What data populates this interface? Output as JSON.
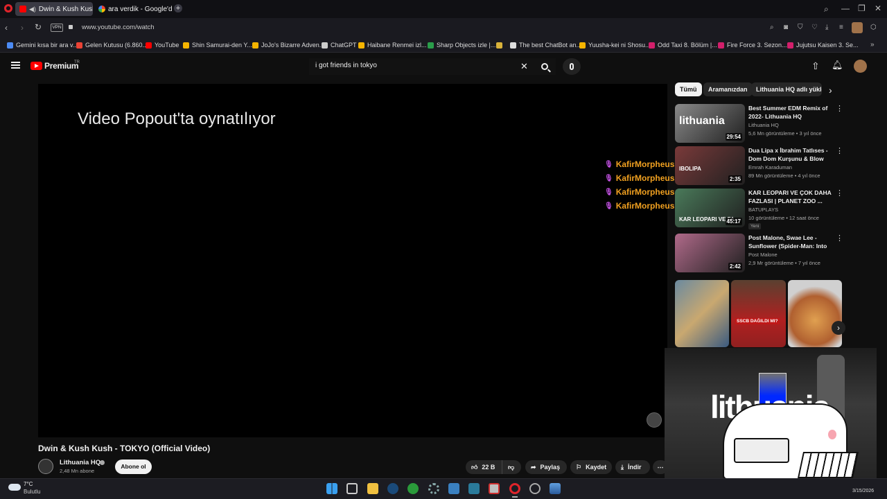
{
  "browser": {
    "tabs": [
      {
        "title": "Dwin & Kush Kush - T"
      },
      {
        "title": "ara verdik - Google'da Ara"
      }
    ],
    "vpn_label": "VPN",
    "url": "www.youtube.com/watch",
    "bookmarks": [
      {
        "label": "Gemini kısa bir ara v...",
        "color": "#4c8bf5"
      },
      {
        "label": "Gelen Kutusu (6.860...",
        "color": "#ea4335"
      },
      {
        "label": "YouTube",
        "color": "#ff0000"
      },
      {
        "label": "Shin Samurai-den Y...",
        "color": "#f5b400"
      },
      {
        "label": "JoJo's Bizarre Adven...",
        "color": "#f5b400"
      },
      {
        "label": "ChatGPT",
        "color": "#cccccc"
      },
      {
        "label": "Haibane Renmei izl...",
        "color": "#f5b400"
      },
      {
        "label": "Sharp Objects izle |...",
        "color": "#2a9d4a"
      },
      {
        "label": "",
        "color": "#d9b23a"
      },
      {
        "label": "The best ChatBot an...",
        "color": "#dddddd"
      },
      {
        "label": "Yuusha-kei ni Shosu...",
        "color": "#f5b400"
      },
      {
        "label": "Odd Taxi 8. Bölüm |...",
        "color": "#d21f6b"
      },
      {
        "label": "Fire Force 3. Sezon...",
        "color": "#d21f6b"
      },
      {
        "label": "Jujutsu Kaisen 3. Se...",
        "color": "#d21f6b"
      }
    ]
  },
  "youtube": {
    "logo_text": "Premium",
    "region": "TR",
    "search_query": "i got friends in tokyo",
    "player_message": "Video Popout'ta oynatılıyor",
    "chat_lines": [
      {
        "user": "KafirMorpheus :"
      },
      {
        "user": "KafirMorpheus :"
      },
      {
        "user": "KafirMorpheus :"
      },
      {
        "user": "KafirMorpheus :"
      }
    ],
    "video_title": "Dwin & Kush Kush - TOKYO (Official Video)",
    "channel_name": "Lithuania HQ",
    "subscribers": "2,48 Mn abone",
    "subscribe_label": "Abone ol",
    "actions": {
      "likes": "22 B",
      "share": "Paylaş",
      "save": "Kaydet",
      "download": "İndir"
    },
    "chips": [
      "Tümü",
      "Aramanızdan",
      "Lithuania HQ adlı yükle"
    ],
    "recommendations": [
      {
        "title": "Best Summer EDM Remix of 2022- Lithuania HQ",
        "channel": "Lithuania HQ",
        "meta": "5,6 Mn görüntüleme • 3 yıl önce",
        "duration": "29:54",
        "thumb_text": "lithuania",
        "thumb_color": "#8a8a8a"
      },
      {
        "title": "Dua Lipa x İbrahim Tatlıses - Dom Dom Kurşunu & Blow You...",
        "channel": "Emrah Karaduman",
        "meta": "89 Mn görüntüleme • 4 yıl önce",
        "duration": "2:35",
        "thumb_text": "IBOLIPA",
        "thumb_color": "#7a3a3a"
      },
      {
        "title": "KAR LEOPARI VE ÇOK DAHA FAZLASI | PLANET ZOO ...",
        "channel": "BATUPLAYS",
        "meta": "10 görüntüleme • 12 saat önce",
        "duration": "45:17",
        "thumb_text": "KAR LEOPARI VE FA...",
        "thumb_color": "#4a7a5a",
        "badge": "Yeni"
      },
      {
        "title": "Post Malone, Swae Lee - Sunflower (Spider-Man: Into th...",
        "channel": "Post Malone",
        "meta": "2,9 Mr görüntüleme • 7 yıl önce",
        "duration": "2:42",
        "thumb_text": "",
        "thumb_color": "#b06a8a"
      }
    ],
    "shelf_caption": "SSCB DAĞILDI MI?",
    "popout_text": "lithuania"
  },
  "taskbar": {
    "temperature": "7°C",
    "weather": "Bulutlu",
    "date": "3/15/2026"
  }
}
